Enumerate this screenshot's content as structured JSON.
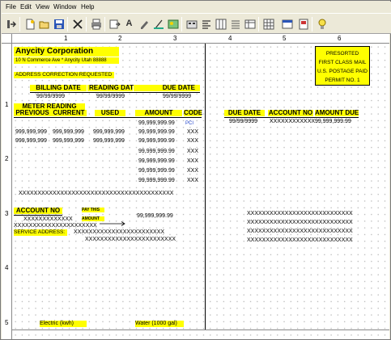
{
  "menu": {
    "file": "File",
    "edit": "Edit",
    "view": "View",
    "window": "Window",
    "help": "Help"
  },
  "toolbar": {
    "buttons": [
      "export-icon",
      "new-icon",
      "open-icon",
      "save-icon",
      "delete-icon",
      "print-icon",
      "insert-field-icon",
      "text-icon",
      "pen-icon",
      "fill-icon",
      "image-icon",
      "properties-icon",
      "align-icon",
      "grid-icon",
      "list-icon",
      "table-icon",
      "table-grid-icon",
      "window-icon",
      "page-icon",
      "wizard-icon"
    ]
  },
  "ruler": {
    "top": [
      "1",
      "2",
      "3",
      "4",
      "5",
      "6"
    ],
    "left": [
      "1",
      "2",
      "3",
      "4",
      "5"
    ]
  },
  "form": {
    "company": "Anycity Corporation",
    "address_line": "10 N Commerce Ave  *  Anycity  Utah  88888",
    "address_correction": "ADDRESS CORRECTION REQUESTED",
    "postage": [
      "PRESORTED",
      "FIRST CLASS MAIL",
      "U.S. POSTAGE PAID",
      "PERMIT NO. 1"
    ],
    "billing_date_label": "BILLING DATE",
    "reading_date_label": "READING DATE",
    "due_date_label": "DUE DATE",
    "billing_date": "99/99/9999",
    "reading_date": "99/99/9999",
    "due_date": "99/99/9999",
    "meter_reading_label": "METER READING",
    "previous_label": "PREVIOUS",
    "current_label": "CURRENT",
    "used_label": "USED",
    "amount_label": "AMOUNT",
    "code_label": "CODE",
    "amount_first": "99,999,999.99",
    "code_first": "PCI",
    "meter_rows": [
      {
        "previous": "999,999,999",
        "current": "999,999,999",
        "used": "999,999,999",
        "amount": "99,999,999.99",
        "code": "XXX"
      },
      {
        "previous": "999,999,999",
        "current": "999,999,999",
        "used": "999,999,999",
        "amount": "99,999,999.99",
        "code": "XXX"
      }
    ],
    "extra_amounts": [
      {
        "amount": "99,999,999.99",
        "code": "XXX"
      },
      {
        "amount": "99,999,999.99",
        "code": "XXX"
      },
      {
        "amount": "99,999,999.99",
        "code": "XXX"
      },
      {
        "amount": "99,999,999.99",
        "code": "XXX"
      }
    ],
    "x_line": "XXXXXXXXXXXXXXXXXXXXXXXXXXXXXXXXXXXXXXXXX",
    "right_due_date_label": "DUE DATE",
    "right_account_no_label": "ACCOUNT NO",
    "right_amount_due_label": "AMOUNT DUE",
    "right_due_date": "99/99/9999",
    "right_account_no": "XXXXXXXXXXXX",
    "right_amount_due": "99,999,999.99",
    "account_no_label": "ACCOUNT NO",
    "pay_this_label": "PAY THIS",
    "amount_small_label": "AMOUNT",
    "account_no_value": "XXXXXXXXXXXXX",
    "pay_amount": "99,999,999.99",
    "name_line": "XXXXXXXXXXXXXXXXXXXXXX",
    "service_address_label": "SERVICE ADDRESS:",
    "service_address_line1": "XXXXXXXXXXXXXXXXXXXXXXXX",
    "service_address_line2": "XXXXXXXXXXXXXXXXXXXXXXXX",
    "right_address_lines": [
      "XXXXXXXXXXXXXXXXXXXXXXXXXXXX",
      "XXXXXXXXXXXXXXXXXXXXXXXXXXXX",
      "XXXXXXXXXXXXXXXXXXXXXXXXXXXX",
      "XXXXXXXXXXXXXXXXXXXXXXXXXXXX"
    ],
    "electric_label": "Electric (kwh)",
    "water_label": "Water (1000 gal)"
  }
}
